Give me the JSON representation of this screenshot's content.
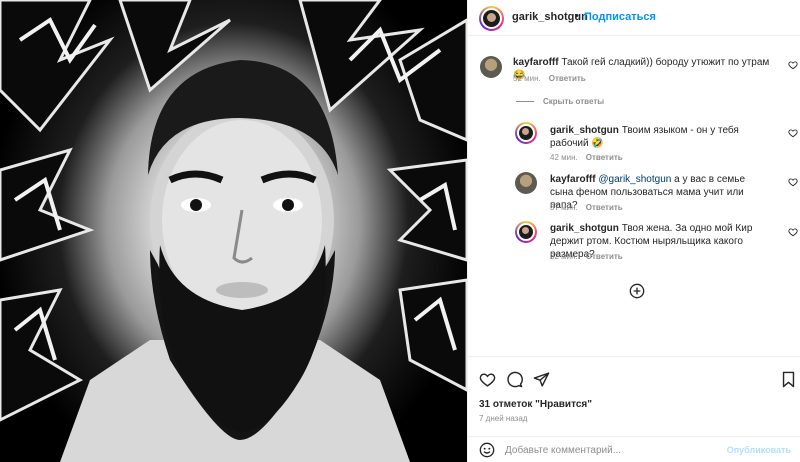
{
  "post": {
    "image_alt": "Black and white portrait of a bearded man on a comic burst background"
  },
  "header": {
    "username": "garik_shotgun",
    "separator": "•",
    "follow_label": "Подписаться"
  },
  "comments": [
    {
      "author": "kayfarofff",
      "text": "Такой гей сладкий)) бороду утюжит по утрам 😂",
      "time": "52 мин.",
      "reply_label": "Ответить"
    }
  ],
  "replies_toggle": "Скрыть ответы",
  "replies": [
    {
      "author": "garik_shotgun",
      "text": "Твоим языком - он у тебя рабочий 🤣",
      "time": "42 мин.",
      "reply_label": "Ответить"
    },
    {
      "author": "kayfarofff",
      "mention": "@garik_shotgun",
      "text": "а у вас в семье сына феном пользоваться мама учит или папа?",
      "time": "37 мин.",
      "reply_label": "Ответить"
    },
    {
      "author": "garik_shotgun",
      "text": "Твоя жена. За одно мой Кир держит ртом. Костюм ныряльщика какого размера?",
      "time": "32 мин.",
      "reply_label": "Ответить"
    }
  ],
  "actions": {
    "likes_text": "31 отметок \"Нравится\"",
    "time_ago": "7 дней назад"
  },
  "add_comment": {
    "placeholder": "Добавьте комментарий...",
    "publish_label": "Опубликовать"
  }
}
